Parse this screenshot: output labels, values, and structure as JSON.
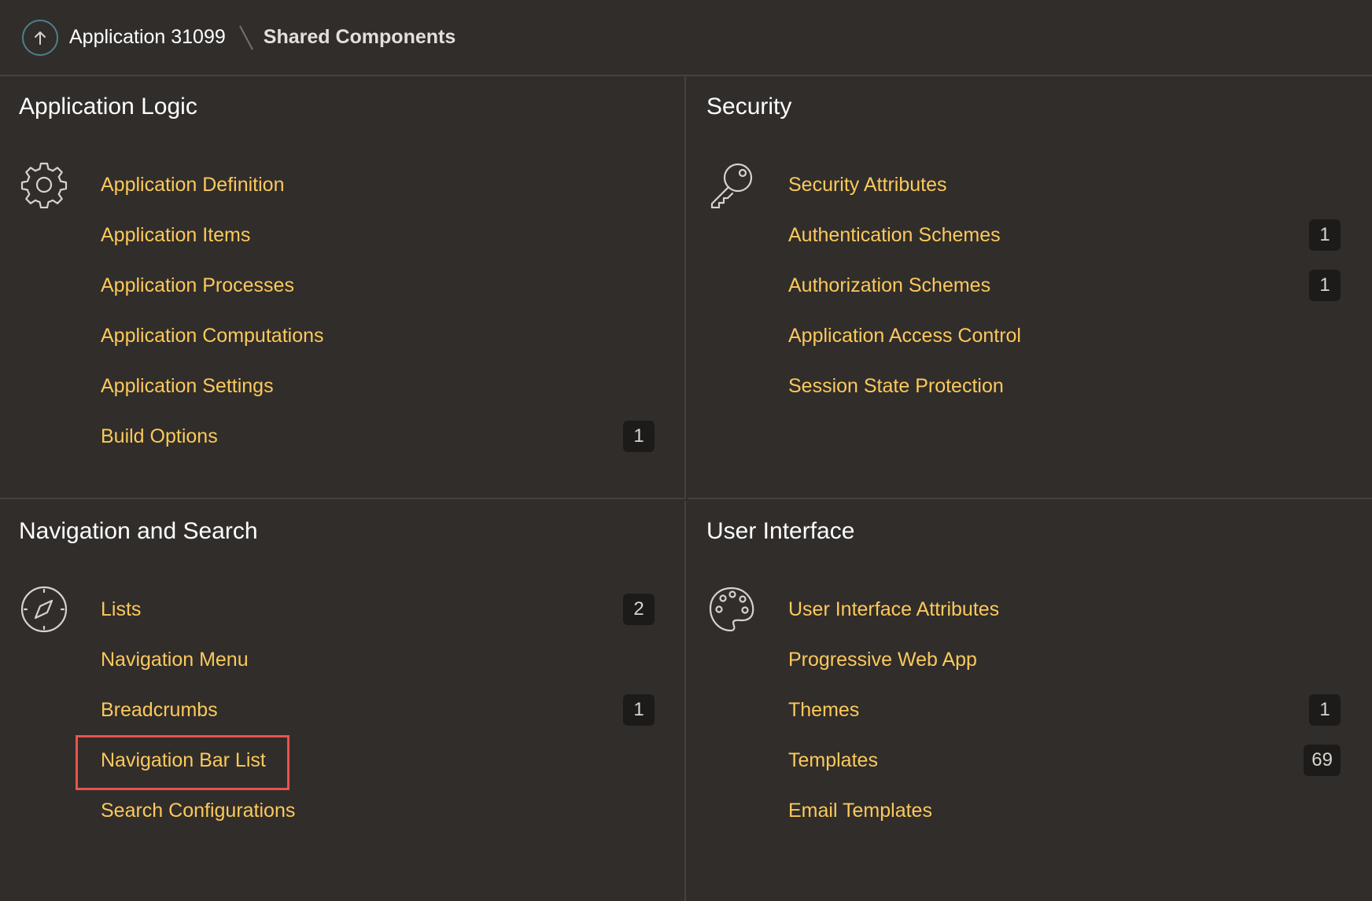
{
  "breadcrumb": {
    "app_link": "Application 31099",
    "current": "Shared Components"
  },
  "panels": {
    "logic": {
      "title": "Application Logic",
      "icon": "gear-icon",
      "items": [
        {
          "label": "Application Definition",
          "badge": ""
        },
        {
          "label": "Application Items",
          "badge": ""
        },
        {
          "label": "Application Processes",
          "badge": ""
        },
        {
          "label": "Application Computations",
          "badge": ""
        },
        {
          "label": "Application Settings",
          "badge": ""
        },
        {
          "label": "Build Options",
          "badge": "1"
        }
      ]
    },
    "security": {
      "title": "Security",
      "icon": "key-icon",
      "items": [
        {
          "label": "Security Attributes",
          "badge": ""
        },
        {
          "label": "Authentication Schemes",
          "badge": "1"
        },
        {
          "label": "Authorization Schemes",
          "badge": "1"
        },
        {
          "label": "Application Access Control",
          "badge": ""
        },
        {
          "label": "Session State Protection",
          "badge": ""
        }
      ]
    },
    "nav": {
      "title": "Navigation and Search",
      "icon": "compass-icon",
      "items": [
        {
          "label": "Lists",
          "badge": "2"
        },
        {
          "label": "Navigation Menu",
          "badge": ""
        },
        {
          "label": "Breadcrumbs",
          "badge": "1"
        },
        {
          "label": "Navigation Bar List",
          "badge": "",
          "highlighted": true
        },
        {
          "label": "Search Configurations",
          "badge": ""
        }
      ]
    },
    "ui": {
      "title": "User Interface",
      "icon": "palette-icon",
      "items": [
        {
          "label": "User Interface Attributes",
          "badge": ""
        },
        {
          "label": "Progressive Web App",
          "badge": ""
        },
        {
          "label": "Themes",
          "badge": "1"
        },
        {
          "label": "Templates",
          "badge": "69"
        },
        {
          "label": "Email Templates",
          "badge": ""
        }
      ]
    }
  },
  "colors": {
    "background": "#312d2a",
    "link": "#fbc95c",
    "highlight": "#e8544d",
    "badge_bg": "#1d1b19"
  }
}
